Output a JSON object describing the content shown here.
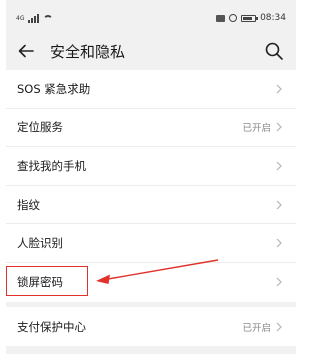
{
  "status_bar": {
    "signal": "4G",
    "time": "08:34"
  },
  "header": {
    "title": "安全和隐私"
  },
  "items": [
    {
      "label": "SOS 紧急求助",
      "value": ""
    },
    {
      "label": "定位服务",
      "value": "已开启"
    },
    {
      "label": "查找我的手机",
      "value": ""
    },
    {
      "label": "指纹",
      "value": ""
    },
    {
      "label": "人脸识别",
      "value": ""
    },
    {
      "label": "锁屏密码",
      "value": ""
    }
  ],
  "items2": [
    {
      "label": "支付保护中心",
      "value": "已开启"
    }
  ],
  "colors": {
    "annotation": "#e0312b",
    "background": "#f1f1f1"
  },
  "icons": [
    "back-arrow-icon",
    "search-icon",
    "chevron-right-icon"
  ]
}
